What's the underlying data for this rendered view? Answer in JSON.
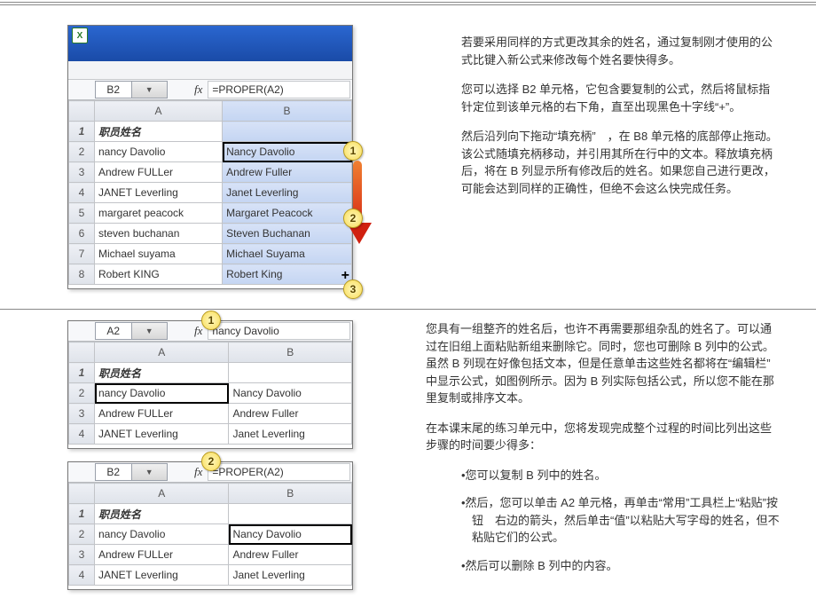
{
  "fig1": {
    "namebox": "B2",
    "fx_label": "fx",
    "formula": "=PROPER(A2)",
    "col_a": "A",
    "col_b": "B",
    "header_row": "职员姓名",
    "rows": [
      {
        "n": "2",
        "a": "nancy Davolio",
        "b": "Nancy Davolio"
      },
      {
        "n": "3",
        "a": "Andrew FULLer",
        "b": "Andrew Fuller"
      },
      {
        "n": "4",
        "a": "JANET Leverling",
        "b": "Janet Leverling"
      },
      {
        "n": "5",
        "a": "margaret peacock",
        "b": "Margaret Peacock"
      },
      {
        "n": "6",
        "a": "steven buchanan",
        "b": "Steven Buchanan"
      },
      {
        "n": "7",
        "a": "Michael suyama",
        "b": "Michael Suyama"
      },
      {
        "n": "8",
        "a": "Robert KING",
        "b": "Robert King"
      }
    ],
    "callouts": {
      "c1": "1",
      "c2": "2",
      "c3": "3"
    }
  },
  "fig2": {
    "namebox": "A2",
    "fx_label": "fx",
    "formula": "nancy Davolio",
    "col_a": "A",
    "col_b": "B",
    "header_row": "职员姓名",
    "rows": [
      {
        "n": "2",
        "a": "nancy Davolio",
        "b": "Nancy Davolio"
      },
      {
        "n": "3",
        "a": "Andrew FULLer",
        "b": "Andrew Fuller"
      },
      {
        "n": "4",
        "a": "JANET Leverling",
        "b": "Janet Leverling"
      }
    ],
    "callout": "1"
  },
  "fig3": {
    "namebox": "B2",
    "fx_label": "fx",
    "formula": "=PROPER(A2)",
    "col_a": "A",
    "col_b": "B",
    "header_row": "职员姓名",
    "rows": [
      {
        "n": "2",
        "a": "nancy Davolio",
        "b": "Nancy Davolio"
      },
      {
        "n": "3",
        "a": "Andrew FULLer",
        "b": "Andrew Fuller"
      },
      {
        "n": "4",
        "a": "JANET Leverling",
        "b": "Janet Leverling"
      }
    ],
    "callout": "2"
  },
  "text1": {
    "p1": "若要采用同样的方式更改其余的姓名，通过复制刚才使用的公式比键入新公式来修改每个姓名要快得多。",
    "p2": "您可以选择 B2 单元格，它包含要复制的公式，然后将鼠标指针定位到该单元格的右下角，直至出现黑色十字线“+”。",
    "p3": "然后沿列向下拖动“填充柄”　，在 B8 单元格的底部停止拖动。该公式随填充柄移动，并引用其所在行中的文本。释放填充柄后，将在 B 列显示所有修改后的姓名。如果您自己进行更改，可能会达到同样的正确性，但绝不会这么快完成任务。"
  },
  "text2": {
    "p1": "您具有一组整齐的姓名后，也许不再需要那组杂乱的姓名了。可以通过在旧组上面粘贴新组来删除它。同时，您也可删除 B 列中的公式。虽然 B 列现在好像包括文本，但是任意单击这些姓名都将在“编辑栏”　中显示公式，如图例所示。因为 B 列实际包括公式，所以您不能在那里复制或排序文本。",
    "p2": "在本课末尾的练习单元中，您将发现完成整个过程的时间比列出这些步骤的时间要少得多：",
    "b1": "•您可以复制 B 列中的姓名。",
    "b2": "•然后，您可以单击 A2 单元格，再单击“常用”工具栏上“粘贴”按钮　右边的箭头，然后单击“值”以粘贴大写字母的姓名，但不粘贴它们的公式。",
    "b3": "•然后可以删除 B 列中的内容。"
  }
}
